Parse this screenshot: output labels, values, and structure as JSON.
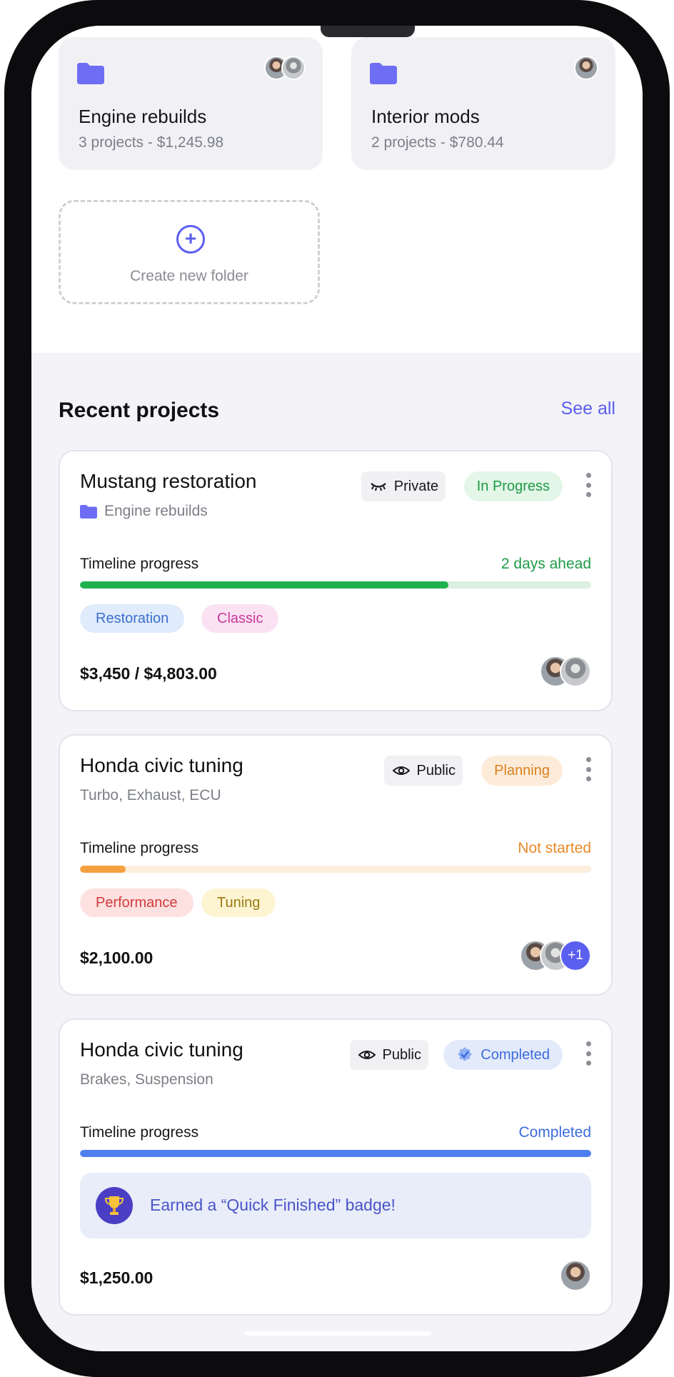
{
  "folders": [
    {
      "name": "Engine rebuilds",
      "meta": "3 projects - $1,245.98"
    },
    {
      "name": "Interior mods",
      "meta": "2 projects - $780.44"
    }
  ],
  "create_folder": {
    "label": "Create new folder"
  },
  "recent": {
    "title": "Recent projects",
    "see_all": "See all",
    "projects": [
      {
        "title": "Mustang restoration",
        "subtitle": "Engine rebuilds",
        "visibility": "Private",
        "status": "In Progress",
        "timeline_label": "Timeline progress",
        "timeline_status": "2 days ahead",
        "progress": 0.72,
        "tags": [
          "Restoration",
          "Classic"
        ],
        "price": "$3,450 / $4,803.00"
      },
      {
        "title": "Honda civic tuning",
        "subtitle": "Turbo, Exhaust, ECU",
        "visibility": "Public",
        "status": "Planning",
        "timeline_label": "Timeline progress",
        "timeline_status": "Not started",
        "progress": 0.09,
        "tags": [
          "Performance",
          "Tuning"
        ],
        "price": "$2,100.00",
        "extra_members": "+1"
      },
      {
        "title": "Honda civic tuning",
        "subtitle": "Brakes, Suspension",
        "visibility": "Public",
        "status": "Completed",
        "timeline_label": "Timeline progress",
        "timeline_status": "Completed",
        "progress": 1.0,
        "achievement": "Earned a “Quick Finished” badge!",
        "price": "$1,250.00"
      }
    ]
  },
  "colors": {
    "accent": "#5b5ff0",
    "green": "#1fb14f",
    "orange": "#f5a041",
    "blue": "#4f7ef0"
  }
}
